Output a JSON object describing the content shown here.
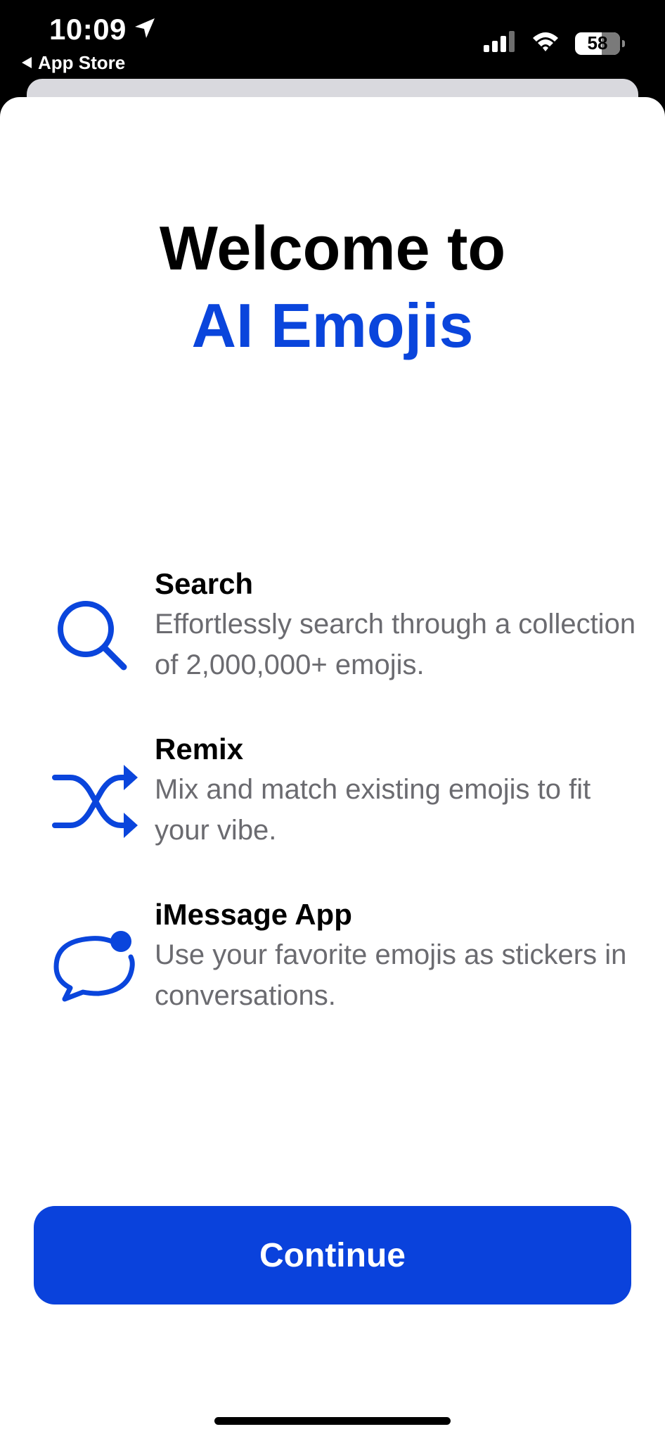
{
  "status_bar": {
    "time": "10:09",
    "back_label": "App Store",
    "battery": "58"
  },
  "welcome": {
    "line1": "Welcome to",
    "line2": "AI Emojis"
  },
  "features": [
    {
      "icon": "magnifying-glass-icon",
      "title": "Search",
      "description": "Effortlessly search through a collection of 2,000,000+ emojis."
    },
    {
      "icon": "shuffle-icon",
      "title": "Remix",
      "description": "Mix and match existing emojis to fit your vibe."
    },
    {
      "icon": "message-bubble-icon",
      "title": "iMessage App",
      "description": "Use your favorite emojis as stickers in conversations."
    }
  ],
  "continue_label": "Continue",
  "colors": {
    "accent": "#0a45dc",
    "button": "#0a42dc",
    "secondary_text": "#6b6b70"
  }
}
